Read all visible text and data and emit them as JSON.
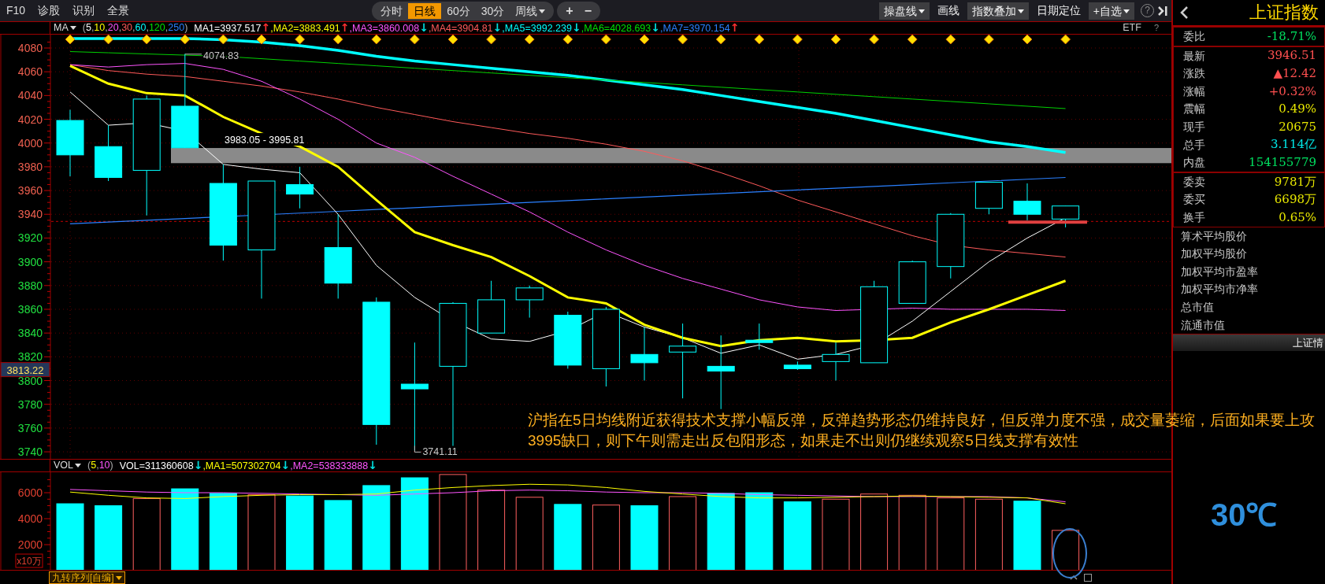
{
  "toolbar_left": [
    {
      "label": "F10"
    },
    {
      "label": "诊股"
    },
    {
      "label": "识别"
    },
    {
      "label": "全景"
    }
  ],
  "period_tabs": [
    {
      "label": "分时",
      "selected": false,
      "dropdown": false
    },
    {
      "label": "日线",
      "selected": true,
      "dropdown": false
    },
    {
      "label": "60分",
      "selected": false,
      "dropdown": false
    },
    {
      "label": "30分",
      "selected": false,
      "dropdown": false
    },
    {
      "label": "周线",
      "selected": false,
      "dropdown": true
    }
  ],
  "zoom_buttons": [
    "+",
    "−"
  ],
  "toolbar_help": "?",
  "toolbar_right": [
    {
      "label": "操盘线",
      "kind": "menu"
    },
    {
      "label": "画线",
      "kind": "plain"
    },
    {
      "label": "指数叠加",
      "kind": "menu"
    },
    {
      "label": "日期定位",
      "kind": "plain"
    },
    {
      "label": "+自选",
      "kind": "menu"
    }
  ],
  "ma_legend": {
    "menu": "MA",
    "open": "(",
    "close": ")",
    "separator": ",",
    "periods": [
      {
        "text": "5",
        "color": "#ffffff"
      },
      {
        "text": "10",
        "color": "#ffff00"
      },
      {
        "text": "20",
        "color": "#ff55ff"
      },
      {
        "text": "30",
        "color": "#ff5a5a"
      },
      {
        "text": "60",
        "color": "#00ffff"
      },
      {
        "text": "120",
        "color": "#00e000"
      },
      {
        "text": "250",
        "color": "#2a80ff"
      }
    ],
    "values": [
      {
        "text": "MA1=3937.517",
        "arrow": {
          "text": "↑",
          "color": "#ff3030"
        },
        "color": "#ffffff"
      },
      {
        "text": ",MA2=3883.491",
        "arrow": {
          "text": "↑",
          "color": "#ff3030"
        },
        "color": "#ffff00"
      },
      {
        "text": ",MA3=3860.008",
        "arrow": {
          "text": "↓",
          "color": "#00e0e0"
        },
        "color": "#ff55ff"
      },
      {
        "text": ",MA4=3904.81",
        "arrow": {
          "text": "↓",
          "color": "#00e0e0"
        },
        "color": "#ff5a5a"
      },
      {
        "text": ",MA5=3992.239",
        "arrow": {
          "text": "↓",
          "color": "#00e0e0"
        },
        "color": "#00ffff"
      },
      {
        "text": ",MA6=4028.693",
        "arrow": {
          "text": "↓",
          "color": "#00e0e0"
        },
        "color": "#00e000"
      },
      {
        "text": ",MA7=3970.154",
        "arrow": {
          "text": "↑",
          "color": "#ff3030"
        },
        "color": "#2a80ff"
      }
    ],
    "etf": "ETF",
    "help": "?"
  },
  "price_axis": {
    "ticks": [
      {
        "label": "4080",
        "kind": "above"
      },
      {
        "label": "4060",
        "kind": "above"
      },
      {
        "label": "4040",
        "kind": "above"
      },
      {
        "label": "4020",
        "kind": "above"
      },
      {
        "label": "4000",
        "kind": "above"
      },
      {
        "label": "3980",
        "kind": "above"
      },
      {
        "label": "3960",
        "kind": "above"
      },
      {
        "label": "3940",
        "kind": "above"
      },
      {
        "label": "3920",
        "kind": "below"
      },
      {
        "label": "3900",
        "kind": "below"
      },
      {
        "label": "3880",
        "kind": "below"
      },
      {
        "label": "3860",
        "kind": "below"
      },
      {
        "label": "3840",
        "kind": "below"
      },
      {
        "label": "3820",
        "kind": "below"
      },
      {
        "label": "3800",
        "kind": "below"
      },
      {
        "label": "3780",
        "kind": "below"
      },
      {
        "label": "3760",
        "kind": "below"
      },
      {
        "label": "3740",
        "kind": "below"
      }
    ],
    "cursor_price": "3813.22"
  },
  "price_chart": {
    "high_label": "4074.83",
    "low_label": "3741.11",
    "gap_label": "3983.05 - 3995.81"
  },
  "annotation": "沪指在5日均线附近获得技术支撑小幅反弹，反弹趋势形态仍维持良好，但反弹力度不强，成交量萎缩，后面如果要上攻3995缺口，则下午则需走出反包阳形态，如果走不出则仍继续观察5日线支撑有效性",
  "volume_legend": {
    "menu": "VOL",
    "open": "(",
    "close": ")",
    "separator": ",",
    "periods": [
      {
        "text": "5",
        "color": "#ffff00"
      },
      {
        "text": "10",
        "color": "#ff55ff"
      }
    ],
    "values": [
      {
        "text": "VOL=311360608",
        "arrow": {
          "text": "↓",
          "color": "#00e0e0"
        },
        "color": "#ffffff"
      },
      {
        "text": ",MA1=507302704",
        "arrow": {
          "text": "↓",
          "color": "#00e0e0"
        },
        "color": "#ffff00"
      },
      {
        "text": ",MA2=538333888",
        "arrow": {
          "text": "↓",
          "color": "#00e0e0"
        },
        "color": "#ff55ff"
      }
    ]
  },
  "volume_axis": {
    "ticks": [
      "6000",
      "4000",
      "2000"
    ],
    "unit": "x10万"
  },
  "bottom_tab": {
    "label": "九转序列[自编]"
  },
  "quote_panel": {
    "title": "上证指数",
    "sections": [
      {
        "rows": [
          {
            "label": "委比",
            "value": "-18.71%",
            "color": "#00e060"
          }
        ]
      },
      {
        "rows": [
          {
            "label": "最新",
            "value": "3946.51",
            "color": "#ff5050"
          },
          {
            "label": "涨跌",
            "value": "▲12.42",
            "color": "#ff5050"
          },
          {
            "label": "涨幅",
            "value": "+0.32%",
            "color": "#ff5050"
          },
          {
            "label": "震幅",
            "value": "0.49%",
            "color": "#e8e800"
          },
          {
            "label": "现手",
            "value": "20675",
            "color": "#e8e800"
          },
          {
            "label": "总手",
            "value": "3.114亿",
            "color": "#00e8e8"
          },
          {
            "label": "内盘",
            "value": "154155779",
            "color": "#00e060"
          }
        ]
      },
      {
        "rows": [
          {
            "label": "委卖",
            "value": "9781万",
            "color": "#e8e800"
          },
          {
            "label": "委买",
            "value": "6698万",
            "color": "#e8e800"
          },
          {
            "label": "换手",
            "value": "0.65%",
            "color": "#e8e800"
          }
        ]
      }
    ],
    "metrics": [
      "算术平均股价",
      "加权平均股价",
      "加权平均市盈率",
      "加权平均市净率",
      "总市值",
      "流通市值"
    ],
    "section_bar": "上证情",
    "weather": "30℃"
  }
}
